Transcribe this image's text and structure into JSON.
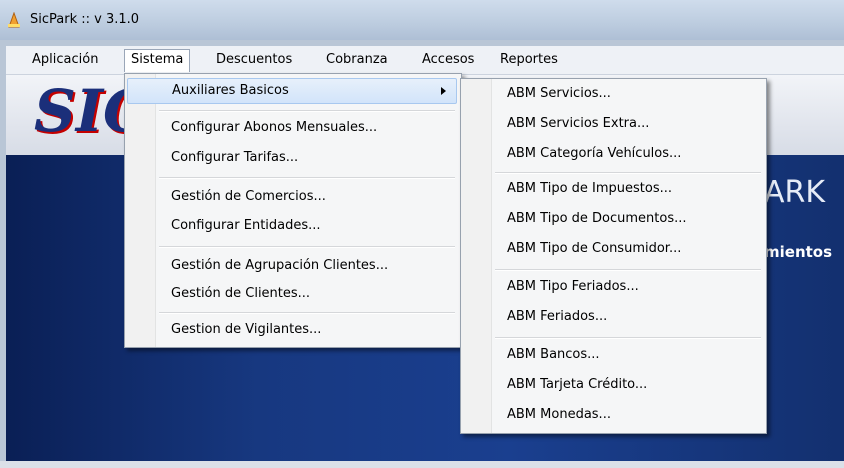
{
  "window": {
    "title": "SicPark :: v 3.1.0"
  },
  "menubar": [
    "Aplicación",
    "Sistema",
    "Descuentos",
    "Cobranza",
    "Accesos",
    "Reportes"
  ],
  "background": {
    "logo_text": "SIC",
    "brand_text": "ARK",
    "sub_text": "mientos"
  },
  "sistema_menu": {
    "items": [
      "Auxiliares Basicos",
      "Configurar Abonos Mensuales...",
      "Configurar Tarifas...",
      "Gestión de Comercios...",
      "Configurar Entidades...",
      "Gestión de Agrupación Clientes...",
      "Gestión de Clientes...",
      "Gestion de Vigilantes..."
    ]
  },
  "auxiliares_menu": {
    "items": [
      "ABM Servicios...",
      "ABM Servicios Extra...",
      "ABM Categoría Vehículos...",
      "ABM Tipo de Impuestos...",
      "ABM Tipo de Documentos...",
      "ABM Tipo de Consumidor...",
      "ABM Tipo Feriados...",
      "ABM Feriados...",
      "ABM Bancos...",
      "ABM Tarjeta Crédito...",
      "ABM Monedas..."
    ]
  },
  "colors": {
    "highlight": "#d2e4fa",
    "logo": "#1b2f7a",
    "logo_shadow": "#c40000",
    "desktop": "#173880"
  }
}
